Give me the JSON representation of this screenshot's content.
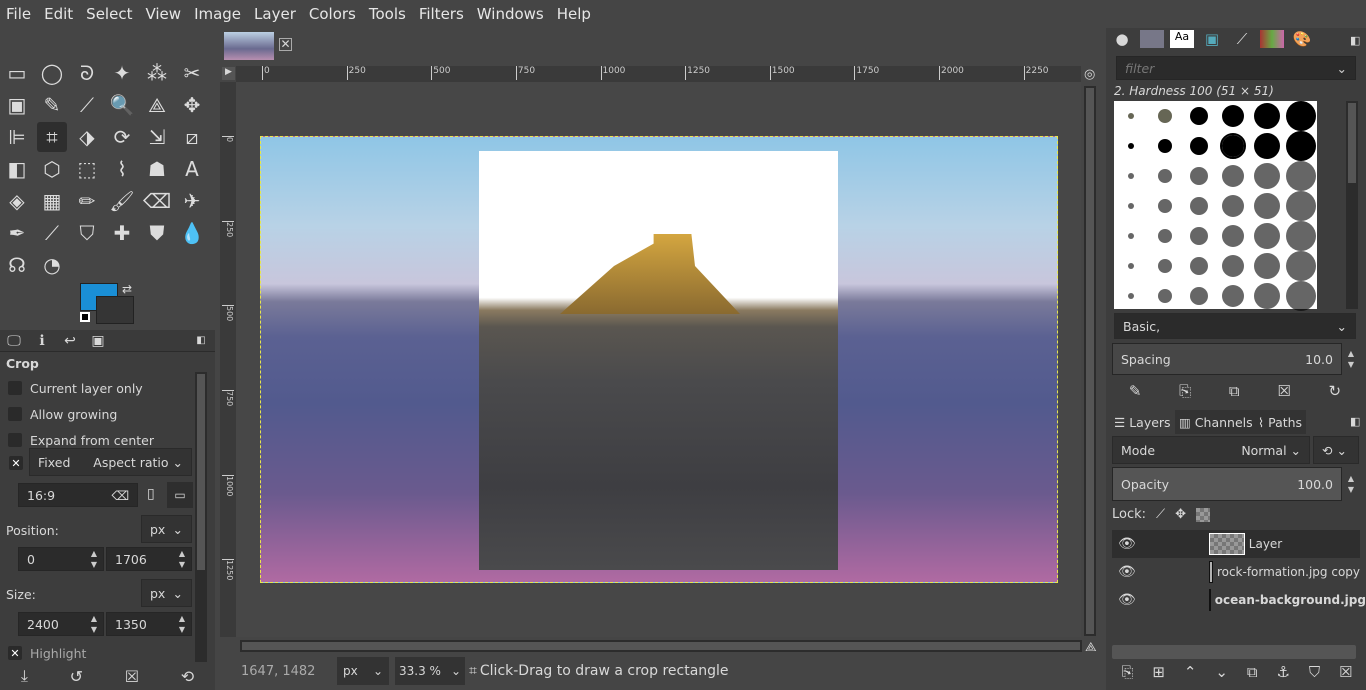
{
  "menu": [
    "File",
    "Edit",
    "Select",
    "View",
    "Image",
    "Layer",
    "Colors",
    "Tools",
    "Filters",
    "Windows",
    "Help"
  ],
  "tools": [
    [
      "rect-select",
      "▭"
    ],
    [
      "ellipse-select",
      "◯"
    ],
    [
      "free-select",
      "ᘐ"
    ],
    [
      "fuzzy-select",
      "✦"
    ],
    [
      "color-select",
      "⁂"
    ],
    [
      "scissors",
      "✂"
    ],
    [
      "foreground-select",
      "▣"
    ],
    [
      "paths",
      "✎"
    ],
    [
      "color-picker",
      "⟋"
    ],
    [
      "zoom",
      "🔍"
    ],
    [
      "measure",
      "⟁"
    ],
    [
      "move",
      "✥"
    ],
    [
      "align",
      "⊫"
    ],
    [
      "crop",
      "⌗"
    ],
    [
      "unified-transform",
      "⬗"
    ],
    [
      "rotate",
      "⟳"
    ],
    [
      "scale",
      "⇲"
    ],
    [
      "shear",
      "⧄"
    ],
    [
      "flip",
      "◧"
    ],
    [
      "perspective",
      "⬡"
    ],
    [
      "3d-transform",
      "⬚"
    ],
    [
      "warp",
      "⌇"
    ],
    [
      "handle-transform",
      "☗"
    ],
    [
      "text",
      "A"
    ],
    [
      "bucket-fill",
      "◈"
    ],
    [
      "gradient",
      "▦"
    ],
    [
      "pencil",
      "✏"
    ],
    [
      "paintbrush",
      "🖌"
    ],
    [
      "eraser",
      "⌫"
    ],
    [
      "airbrush",
      "✈"
    ],
    [
      "ink",
      "✒"
    ],
    [
      "mypaint-brush",
      "⟋"
    ],
    [
      "clone",
      "⛉"
    ],
    [
      "heal",
      "✚"
    ],
    [
      "perspective-clone",
      "⛊"
    ],
    [
      "blur",
      "💧"
    ],
    [
      "smudge",
      "☊"
    ],
    [
      "dodge-burn",
      "◔"
    ]
  ],
  "tool_options": {
    "tabs": [
      "tool-options",
      "device-status",
      "undo-history",
      "images"
    ],
    "title": "Crop",
    "current_layer_only": "Current layer only",
    "allow_growing": "Allow growing",
    "expand_from_center": "Expand from center",
    "fixed": "Fixed",
    "fixed_checked": true,
    "aspect_mode": "Aspect ratio",
    "ratio": "16:9",
    "position_label": "Position:",
    "position_unit": "px",
    "pos_x": "0",
    "pos_y": "1706",
    "size_label": "Size:",
    "size_unit": "px",
    "size_w": "2400",
    "size_h": "1350",
    "highlight": "Highlight",
    "highlight_checked": true
  },
  "colors": {
    "foreground": "#1a8fd6",
    "background": "#353535"
  },
  "ruler": {
    "h": [
      "0",
      "250",
      "500",
      "750",
      "1000",
      "1250",
      "1500",
      "1750",
      "2000",
      "2250"
    ],
    "v": [
      "0",
      "250",
      "500",
      "750",
      "1000",
      "1250"
    ]
  },
  "status": {
    "coords": "1647, 1482",
    "unit": "px",
    "zoom": "33.3 %",
    "message": "Click-Drag to draw a crop rectangle"
  },
  "brushes": {
    "filter_placeholder": "filter",
    "selected": "2. Hardness 100 (51 × 51)",
    "tag": "Basic,",
    "spacing_label": "Spacing",
    "spacing": "10.0"
  },
  "layers_panel": {
    "tabs": [
      "Layers",
      "Channels",
      "Paths"
    ],
    "mode_label": "Mode",
    "mode": "Normal",
    "opacity_label": "Opacity",
    "opacity": "100.0",
    "lock_label": "Lock:",
    "layers": [
      {
        "name": "Layer",
        "visible": true,
        "selected": true
      },
      {
        "name": "rock-formation.jpg copy",
        "visible": true,
        "selected": false
      },
      {
        "name": "ocean-background.jpg",
        "visible": true,
        "selected": false,
        "bold": true
      }
    ]
  }
}
